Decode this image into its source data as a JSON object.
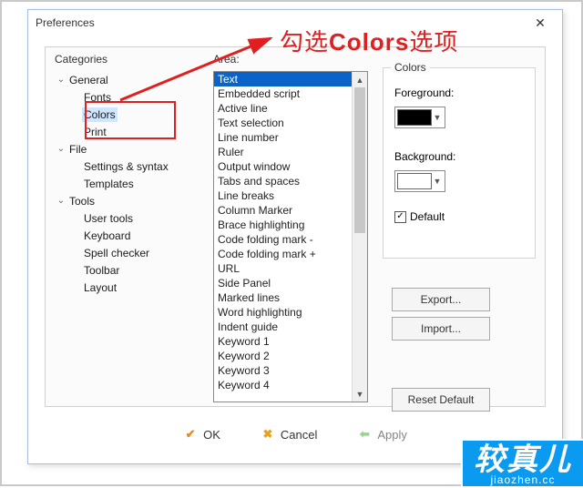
{
  "dialog": {
    "title": "Preferences"
  },
  "labels": {
    "categories": "Categories",
    "area": "Area:"
  },
  "tree": {
    "general": "General",
    "fonts": "Fonts",
    "colors": "Colors",
    "print": "Print",
    "file": "File",
    "settings_syntax": "Settings & syntax",
    "templates": "Templates",
    "tools": "Tools",
    "user_tools": "User tools",
    "keyboard": "Keyboard",
    "spell_checker": "Spell checker",
    "toolbar": "Toolbar",
    "layout": "Layout"
  },
  "area_items": [
    "Text",
    "Embedded script",
    "Active line",
    "Text selection",
    "Line number",
    "Ruler",
    "Output window",
    "Tabs and spaces",
    "Line breaks",
    "Column Marker",
    "Brace highlighting",
    "Code folding mark -",
    "Code folding mark +",
    "URL",
    "Side Panel",
    "Marked lines",
    "Word highlighting",
    "Indent guide",
    "Keyword 1",
    "Keyword 2",
    "Keyword 3",
    "Keyword 4"
  ],
  "colors": {
    "group_title": "Colors",
    "foreground": "Foreground:",
    "background": "Background:",
    "default_label": "Default",
    "default_checked": "✓",
    "fg_value": "#000000",
    "bg_value": "#ffffff"
  },
  "buttons": {
    "export": "Export...",
    "import": "Import...",
    "reset": "Reset Default",
    "ok": "OK",
    "cancel": "Cancel",
    "apply": "Apply"
  },
  "annotation": {
    "prefix": "勾选",
    "word": "Colors",
    "suffix": "选项"
  },
  "logo": {
    "big": "较真儿",
    "small": "jiaozhen.cc"
  }
}
